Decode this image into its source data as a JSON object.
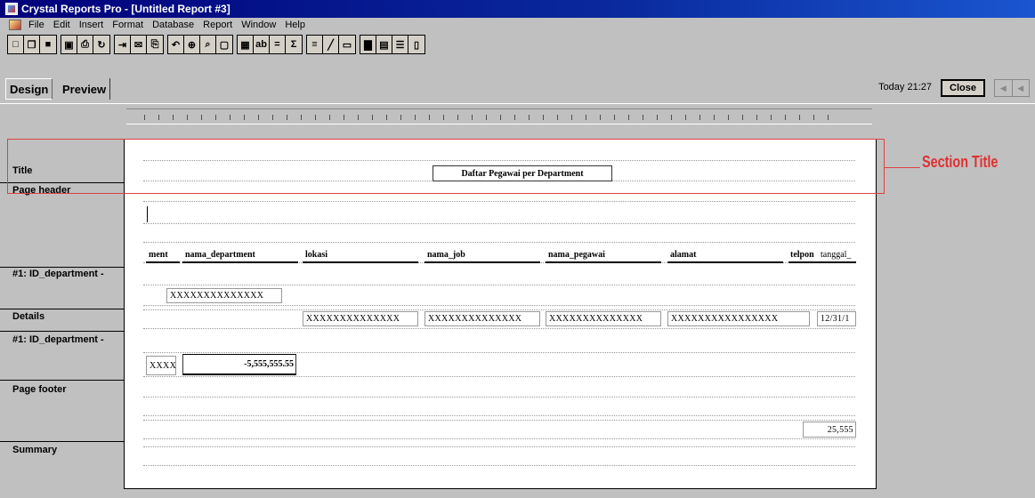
{
  "window": {
    "title": "Crystal Reports Pro - [Untitled Report #3]"
  },
  "menu": [
    "File",
    "Edit",
    "Insert",
    "Format",
    "Database",
    "Report",
    "Window",
    "Help"
  ],
  "toolbar": {
    "groups": [
      [
        "new-icon",
        "open-icon",
        "save-icon"
      ],
      [
        "print-preview-icon",
        "print-icon",
        "refresh-icon"
      ],
      [
        "export-icon",
        "mail-icon",
        "copy-icon"
      ],
      [
        "undo-icon",
        "zoom-icon",
        "find-icon",
        "select-icon"
      ],
      [
        "insert-database-field-icon",
        "insert-text-icon",
        "insert-formula-icon",
        "insert-summary-icon"
      ],
      [
        "insert-group-icon",
        "insert-line-icon",
        "insert-box-icon"
      ],
      [
        "insert-chart-icon",
        "insert-picture-icon",
        "align-icon",
        "section-icon"
      ]
    ],
    "close_label": "Close"
  },
  "tabs": {
    "design": "Design",
    "preview": "Preview"
  },
  "status": {
    "today": "Today 21:27"
  },
  "sections": {
    "title": "Title",
    "page_header": "Page header",
    "group_header": "#1: ID_department -",
    "details": "Details",
    "group_footer": "#1: ID_department -",
    "page_footer": "Page footer",
    "summary": "Summary"
  },
  "report": {
    "title_text": "Daftar Pegawai per Department",
    "column_headers": [
      "ment",
      "nama_department",
      "lokasi",
      "nama_job",
      "nama_pegawai",
      "alamat",
      "telpon",
      "tanggal_"
    ],
    "group_field": "XXXXXXXXXXXXXX",
    "detail_fields": [
      "XXXXXXXXXXXXXX",
      "XXXXXXXXXXXXXX",
      "XXXXXXXXXXXXXX",
      "XXXXXXXXXXXXXXXX",
      "12/31/1"
    ],
    "group_count": "XXXX",
    "group_sum": "-5,555,555.55",
    "page_number": "25,555"
  },
  "annotation": {
    "label": "Section Title",
    "color": "#e03030"
  }
}
